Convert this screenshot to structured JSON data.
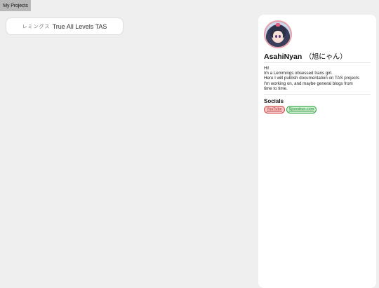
{
  "tabs": [
    {
      "label": "My Projects"
    }
  ],
  "projects": [
    {
      "jp_prefix": "レミングス",
      "title": "True All Levels TAS"
    }
  ],
  "profile": {
    "name": "AsahiNyan",
    "name_jp": "（旭にゃん）",
    "bio_lines": [
      "Hi!",
      "Im a Lemmings obsessed trans girl.",
      "Here I will publish documentation on TAS projects",
      "I'm working on, and maybe general blogs from",
      "time to time."
    ],
    "socials_heading": "Socials",
    "socials": [
      {
        "label": "YouTube",
        "color": "#d04848"
      },
      {
        "label": "Speedrun.com",
        "color": "#3aa04a"
      }
    ]
  }
}
